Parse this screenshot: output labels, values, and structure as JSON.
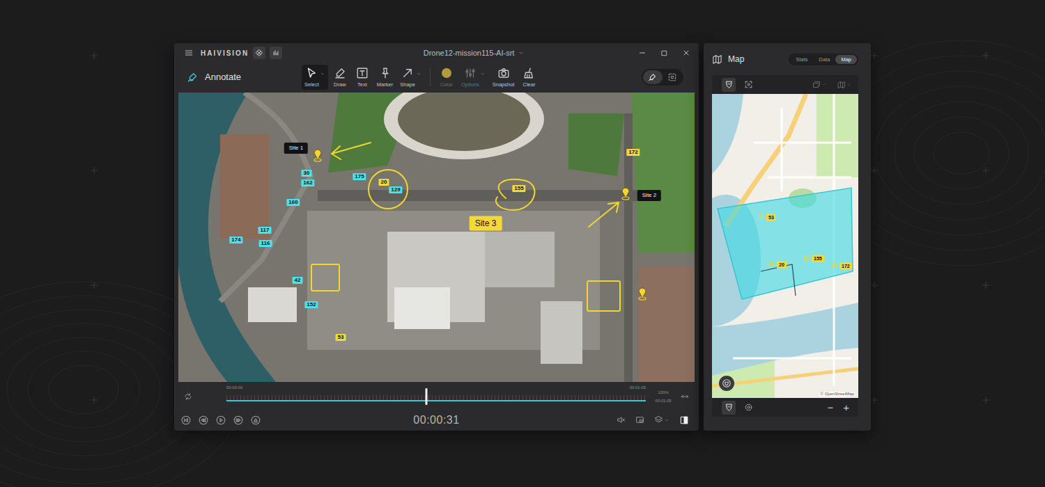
{
  "window": {
    "brand": "HAIVISION",
    "title": "Drone12-mission115-AI-srt"
  },
  "toolbar": {
    "mode": "Annotate",
    "tools": [
      {
        "label": "Select",
        "selected": true,
        "disabled": false,
        "has_menu": true
      },
      {
        "label": "Draw",
        "selected": false,
        "disabled": false,
        "has_menu": false
      },
      {
        "label": "Text",
        "selected": false,
        "disabled": false,
        "has_menu": false
      },
      {
        "label": "Marker",
        "selected": false,
        "disabled": false,
        "has_menu": false
      },
      {
        "label": "Shape",
        "selected": false,
        "disabled": false,
        "has_menu": true
      },
      {
        "label": "Color",
        "selected": false,
        "disabled": true,
        "has_menu": false,
        "swatch": "#b39b3a"
      },
      {
        "label": "Options",
        "selected": false,
        "disabled": true,
        "has_menu": true
      },
      {
        "label": "Snapshot",
        "selected": false,
        "disabled": false,
        "has_menu": false
      },
      {
        "label": "Clear",
        "selected": false,
        "disabled": false,
        "has_menu": false
      }
    ],
    "view_modes": [
      {
        "kind": "annotate",
        "selected": true
      },
      {
        "kind": "ai",
        "selected": false
      }
    ]
  },
  "video": {
    "sites": [
      {
        "label": "Site 1",
        "kind": "tag"
      },
      {
        "label": "Site 2",
        "kind": "tag"
      },
      {
        "label": "Site 3",
        "kind": "callout"
      }
    ],
    "detections": [
      {
        "label": "172",
        "color": "#f5d83a"
      },
      {
        "label": "30",
        "color": "#4fe0ea"
      },
      {
        "label": "162",
        "color": "#4fe0ea"
      },
      {
        "label": "175",
        "color": "#4fe0ea"
      },
      {
        "label": "20",
        "color": "#f5d83a"
      },
      {
        "label": "129",
        "color": "#4fe0ea"
      },
      {
        "label": "155",
        "color": "#f5d83a"
      },
      {
        "label": "160",
        "color": "#4fe0ea"
      },
      {
        "label": "117",
        "color": "#4fe0ea"
      },
      {
        "label": "174",
        "color": "#4fe0ea"
      },
      {
        "label": "116",
        "color": "#4fe0ea"
      },
      {
        "label": "42",
        "color": "#4fe0ea"
      },
      {
        "label": "152",
        "color": "#4fe0ea"
      },
      {
        "label": "53",
        "color": "#f5d83a"
      }
    ]
  },
  "timeline": {
    "start": "00:00:00",
    "end": "00:01:05",
    "zoom": "100%",
    "duration": "00:01:05",
    "level": 0.477
  },
  "player": {
    "time": "00:00:31"
  },
  "map_panel": {
    "title": "Map",
    "tabs": [
      {
        "label": "Stats",
        "selected": false
      },
      {
        "label": "Data",
        "selected": false
      },
      {
        "label": "Map",
        "selected": true
      }
    ],
    "tools": [
      {
        "kind": "shield",
        "selected": true
      },
      {
        "kind": "focus",
        "selected": false
      }
    ],
    "pins": [
      {
        "label": "53"
      },
      {
        "label": "20"
      },
      {
        "label": "155"
      },
      {
        "label": "172"
      }
    ],
    "attribution": "© OpenStreetMap",
    "zoom_out": "−",
    "zoom_in": "+"
  }
}
